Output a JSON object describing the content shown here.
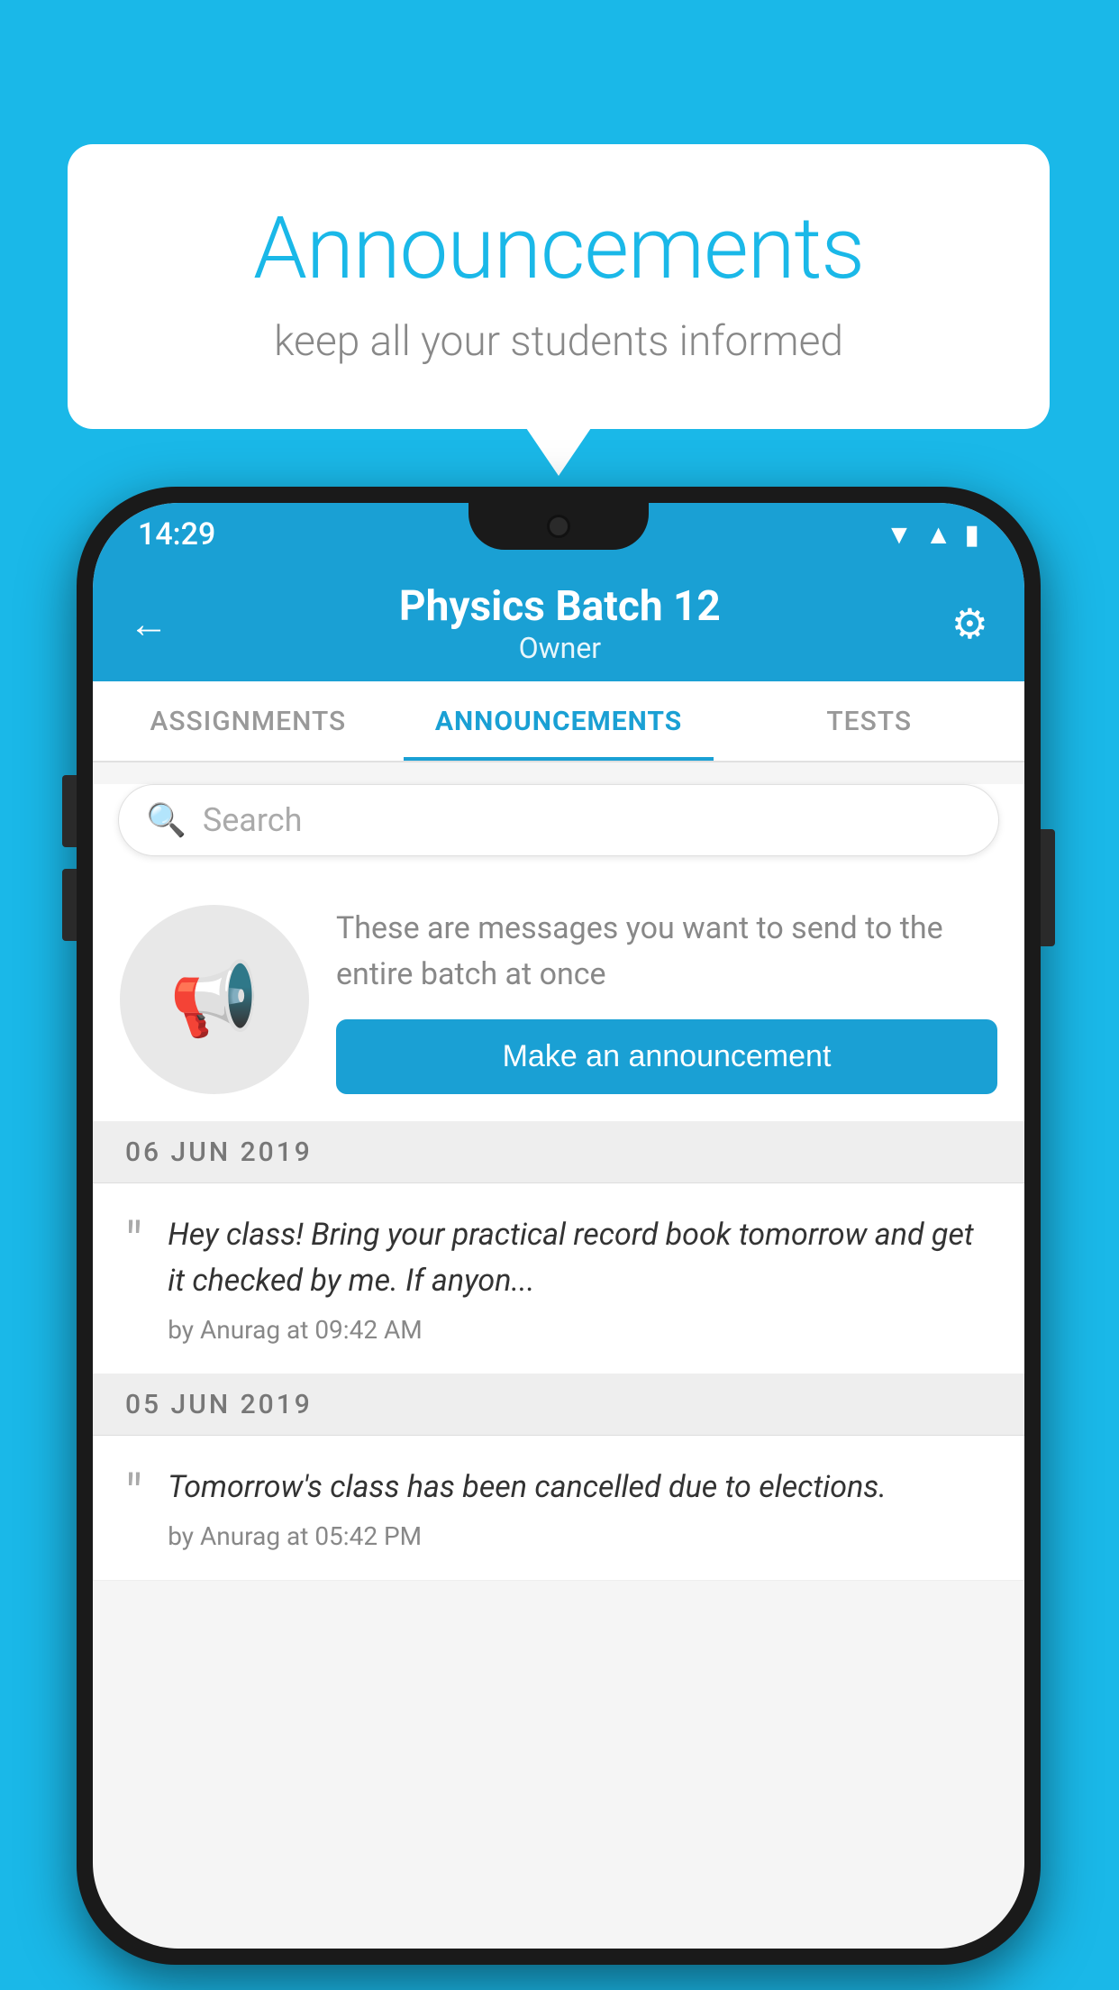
{
  "bubble": {
    "title": "Announcements",
    "subtitle": "keep all your students informed"
  },
  "status_bar": {
    "time": "14:29"
  },
  "header": {
    "title": "Physics Batch 12",
    "subtitle": "Owner"
  },
  "tabs": [
    {
      "label": "ASSIGNMENTS",
      "active": false
    },
    {
      "label": "ANNOUNCEMENTS",
      "active": true
    },
    {
      "label": "TESTS",
      "active": false
    },
    {
      "label": "...",
      "active": false
    }
  ],
  "search": {
    "placeholder": "Search"
  },
  "promo": {
    "description": "These are messages you want to send to the entire batch at once",
    "button_label": "Make an announcement"
  },
  "announcements": [
    {
      "date": "06  JUN  2019",
      "text": "Hey class! Bring your practical record book tomorrow and get it checked by me. If anyon...",
      "meta": "by Anurag at 09:42 AM"
    },
    {
      "date": "05  JUN  2019",
      "text": "Tomorrow's class has been cancelled due to elections.",
      "meta": "by Anurag at 05:42 PM"
    }
  ],
  "colors": {
    "accent": "#1aa0d4",
    "background": "#1ab8e8",
    "tab_active": "#1aa0d4",
    "tab_inactive": "#999999"
  }
}
